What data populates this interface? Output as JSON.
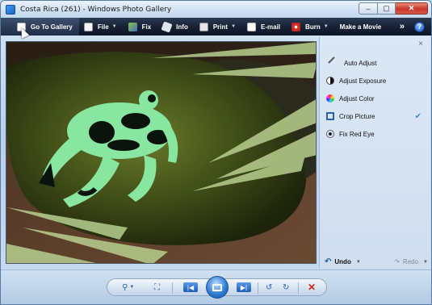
{
  "window": {
    "title": "Costa Rica (261) - Windows Photo Gallery"
  },
  "toolbar": {
    "items": [
      {
        "label": "Go To Gallery",
        "icon": "gallery-icon"
      },
      {
        "label": "File",
        "icon": "file-icon"
      },
      {
        "label": "Fix",
        "icon": "fix-icon"
      },
      {
        "label": "Info",
        "icon": "info-icon"
      },
      {
        "label": "Print",
        "icon": "print-icon"
      },
      {
        "label": "E-mail",
        "icon": "email-icon"
      },
      {
        "label": "Burn",
        "icon": "burn-icon"
      },
      {
        "label": "Make a Movie",
        "icon": "movie-icon"
      }
    ],
    "overflow": "»",
    "help": "?"
  },
  "fix_panel": {
    "close": "×",
    "items": [
      {
        "label": "Auto Adjust",
        "icon": "magic-wand-icon"
      },
      {
        "label": "Adjust Exposure",
        "icon": "exposure-icon"
      },
      {
        "label": "Adjust Color",
        "icon": "color-wheel-icon"
      },
      {
        "label": "Crop Picture",
        "icon": "crop-icon",
        "checked": true
      },
      {
        "label": "Fix Red Eye",
        "icon": "red-eye-icon"
      }
    ],
    "checkmark": "✔",
    "undo_label": "Undo",
    "redo_label": "Redo"
  },
  "bottom_controls": {
    "zoom": "zoom-icon",
    "actual_size": "actual-size-icon",
    "previous": "previous-icon",
    "slideshow": "slideshow-icon",
    "next": "next-icon",
    "rotate_ccw": "rotate-counterclockwise-icon",
    "rotate_cw": "rotate-clockwise-icon",
    "delete": "delete-icon"
  }
}
